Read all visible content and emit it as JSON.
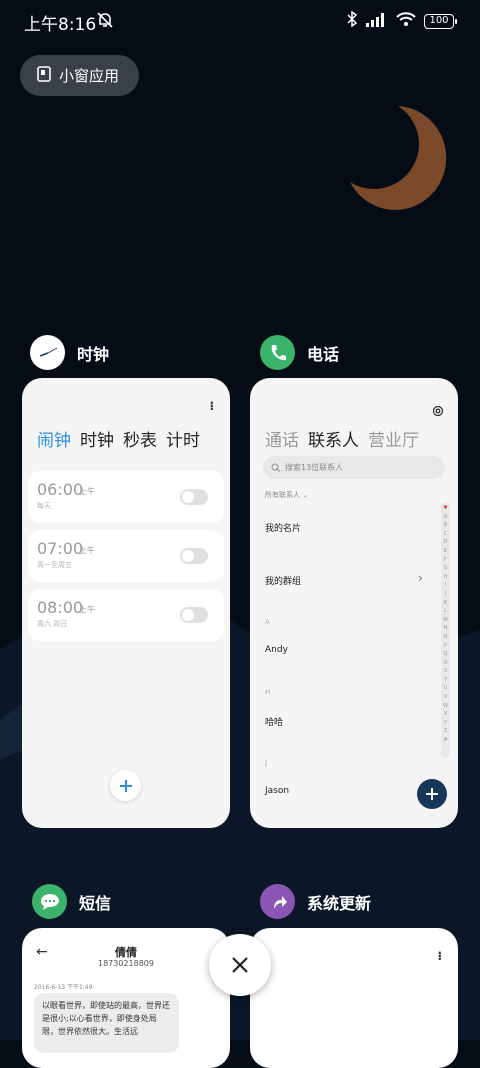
{
  "status": {
    "time": "上午8:16",
    "battery": "100"
  },
  "small_window_button": "小窗应用",
  "cards": {
    "clock": {
      "title": "时钟",
      "tabs": [
        "闹钟",
        "时钟",
        "秒表",
        "计时"
      ],
      "alarms": [
        {
          "time": "06:00",
          "ampm": "上午",
          "days": "每天"
        },
        {
          "time": "07:00",
          "ampm": "上午",
          "days": "周一至周五"
        },
        {
          "time": "08:00",
          "ampm": "上午",
          "days": "周六 周日"
        }
      ]
    },
    "phone": {
      "title": "电话",
      "tabs": [
        "通话",
        "联系人",
        "营业厅"
      ],
      "search_placeholder": "搜索13位联系人",
      "all_contacts": "所有联系人",
      "my_card": "我的名片",
      "my_groups": "我的群组",
      "sections": [
        {
          "letter": "A",
          "name": "Andy"
        },
        {
          "letter": "H",
          "name": "哈哈"
        },
        {
          "letter": "J",
          "name": "Jason"
        }
      ],
      "alphabet": [
        "♥",
        "A",
        "B",
        "C",
        "D",
        "E",
        "F",
        "G",
        "H",
        "I",
        "J",
        "K",
        "L",
        "M",
        "N",
        "O",
        "P",
        "Q",
        "R",
        "S",
        "T",
        "U",
        "V",
        "W",
        "X",
        "Y",
        "Z",
        "#"
      ]
    },
    "sms": {
      "title": "短信",
      "contact_name": "倩倩",
      "contact_number": "18730218809",
      "timestamp": "2016-6-13 下午1:49",
      "message": "以眼看世界，即使站的最高，世界还是很小;以心看世界，即使身处局限，世界依然很大。生活远"
    },
    "update": {
      "title": "系统更新"
    }
  },
  "colors": {
    "clock_accent": "#2b8ee6",
    "phone_icon": "#3bb36a",
    "sms_icon": "#3bb36a",
    "update_icon": "#8a55b4",
    "moon": "#7a4a2a",
    "phone_fab": "#17375a"
  }
}
